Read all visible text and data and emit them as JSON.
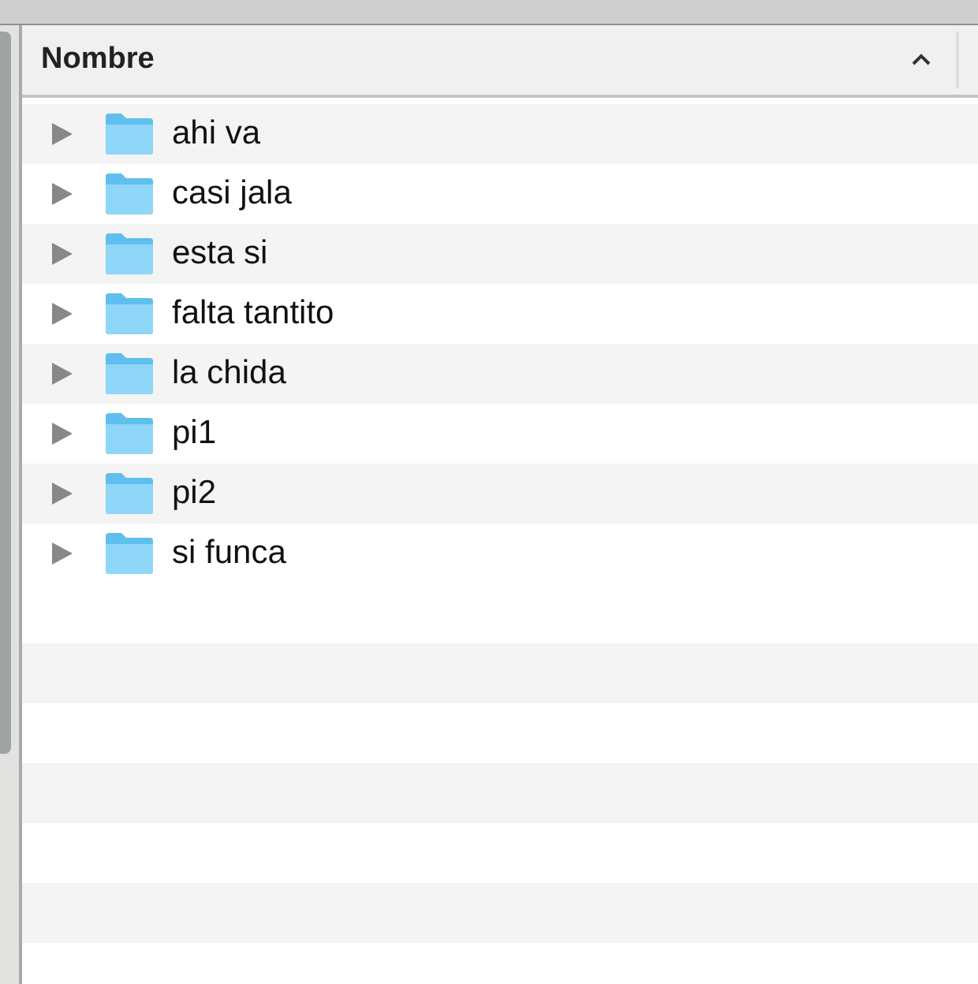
{
  "column_header": {
    "label": "Nombre",
    "sorted_ascending": true
  },
  "rows": [
    {
      "name": "ahi va",
      "expanded": false
    },
    {
      "name": "casi jala",
      "expanded": false
    },
    {
      "name": "esta si",
      "expanded": false
    },
    {
      "name": "falta tantito",
      "expanded": false
    },
    {
      "name": "la chida",
      "expanded": false
    },
    {
      "name": "pi1",
      "expanded": false
    },
    {
      "name": "pi2",
      "expanded": false
    },
    {
      "name": "si funca",
      "expanded": false
    }
  ]
}
